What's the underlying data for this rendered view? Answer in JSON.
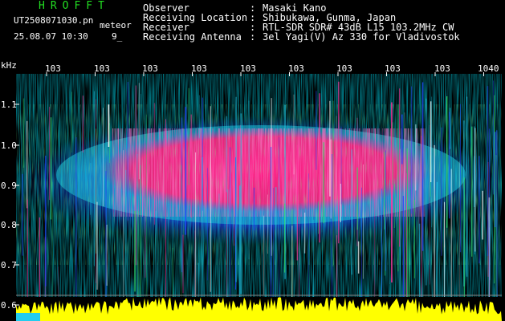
{
  "header": {
    "app_title": "HROFFT",
    "file_name": "UT2508071030.pn",
    "mode": "meteor",
    "datetime": "25.08.07 10:30",
    "count": "9_"
  },
  "station_info": [
    {
      "label": "Observer",
      "value": "Masaki Kano"
    },
    {
      "label": "Receiving Location",
      "value": "Shibukawa, Gunma, Japan"
    },
    {
      "label": "Receiver",
      "value": "RTL-SDR SDR# 43dB L15 103.2MHz CW"
    },
    {
      "label": "Receiving Antenna",
      "value": "3el Yagi(V) Az 330 for Vladivostok"
    }
  ],
  "separator": ":",
  "axes": {
    "unit": "kHz",
    "y_ticks": [
      "1.1",
      "1.0",
      "0.9",
      "0.8",
      "0.7",
      "0.6"
    ],
    "x_ticks": [
      "103",
      "103",
      "103",
      "103",
      "103",
      "103",
      "103",
      "103",
      "103",
      "1040"
    ]
  },
  "colors": {
    "title_green": "#22dd22",
    "background": "#000000",
    "echo_magenta": "#ff2288",
    "noise_blue": "#1133cc",
    "signal_cyan": "#22ccdd",
    "power_yellow": "#ffff00"
  }
}
